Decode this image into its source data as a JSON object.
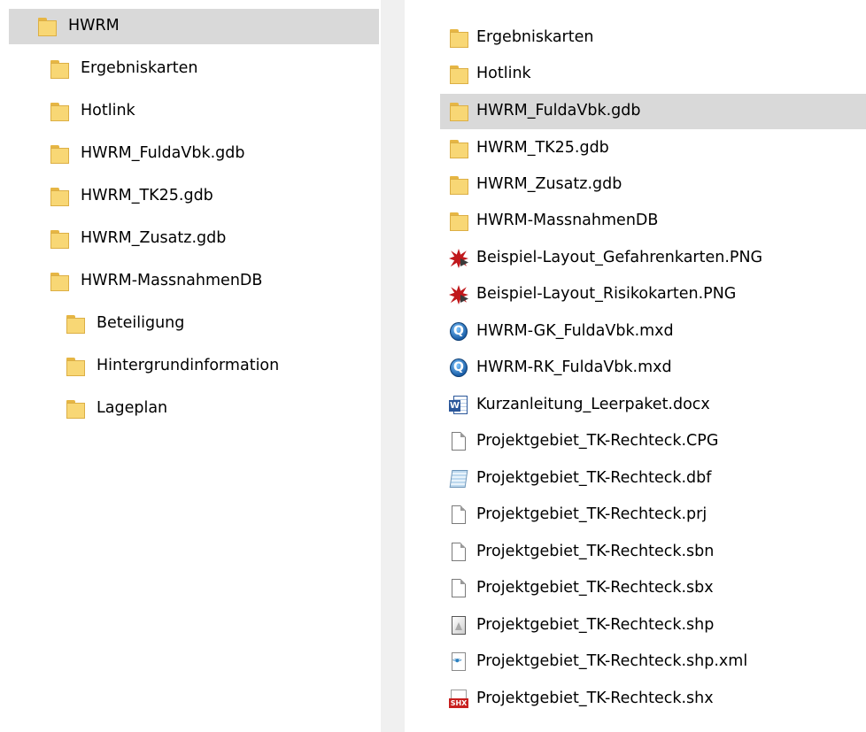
{
  "tree": {
    "items": [
      {
        "label": "HWRM",
        "icon": "folder-icon"
      },
      {
        "label": "Ergebniskarten",
        "icon": "folder-icon"
      },
      {
        "label": "Hotlink",
        "icon": "folder-icon"
      },
      {
        "label": "HWRM_FuldaVbk.gdb",
        "icon": "folder-icon"
      },
      {
        "label": "HWRM_TK25.gdb",
        "icon": "folder-icon"
      },
      {
        "label": "HWRM_Zusatz.gdb",
        "icon": "folder-icon"
      },
      {
        "label": "HWRM-MassnahmenDB",
        "icon": "folder-icon"
      },
      {
        "label": "Beteiligung",
        "icon": "folder-icon"
      },
      {
        "label": "Hintergrundinformation",
        "icon": "folder-icon"
      },
      {
        "label": "Lageplan",
        "icon": "folder-icon"
      }
    ]
  },
  "files": {
    "items": [
      {
        "label": "Ergebniskarten",
        "icon": "folder-icon"
      },
      {
        "label": "Hotlink",
        "icon": "folder-icon"
      },
      {
        "label": "HWRM_FuldaVbk.gdb",
        "icon": "folder-icon"
      },
      {
        "label": "HWRM_TK25.gdb",
        "icon": "folder-icon"
      },
      {
        "label": "HWRM_Zusatz.gdb",
        "icon": "folder-icon"
      },
      {
        "label": "HWRM-MassnahmenDB",
        "icon": "folder-icon"
      },
      {
        "label": "Beispiel-Layout_Gefahrenkarten.PNG",
        "icon": "png-image-icon"
      },
      {
        "label": "Beispiel-Layout_Risikokarten.PNG",
        "icon": "png-image-icon"
      },
      {
        "label": "HWRM-GK_FuldaVbk.mxd",
        "icon": "arcmap-document-icon"
      },
      {
        "label": "HWRM-RK_FuldaVbk.mxd",
        "icon": "arcmap-document-icon"
      },
      {
        "label": "Kurzanleitung_Leerpaket.docx",
        "icon": "word-document-icon"
      },
      {
        "label": "Projektgebiet_TK-Rechteck.CPG",
        "icon": "blank-file-icon"
      },
      {
        "label": "Projektgebiet_TK-Rechteck.dbf",
        "icon": "dbf-table-icon"
      },
      {
        "label": "Projektgebiet_TK-Rechteck.prj",
        "icon": "blank-file-icon"
      },
      {
        "label": "Projektgebiet_TK-Rechteck.sbn",
        "icon": "blank-file-icon"
      },
      {
        "label": "Projektgebiet_TK-Rechteck.sbx",
        "icon": "blank-file-icon"
      },
      {
        "label": "Projektgebiet_TK-Rechteck.shp",
        "icon": "shapefile-icon"
      },
      {
        "label": "Projektgebiet_TK-Rechteck.shp.xml",
        "icon": "xml-file-icon"
      },
      {
        "label": "Projektgebiet_TK-Rechteck.shx",
        "icon": "shx-file-icon"
      }
    ]
  },
  "colors": {
    "selection": "#d9d9d9",
    "folder": "#f8d775",
    "divider": "#f0f0f0"
  }
}
